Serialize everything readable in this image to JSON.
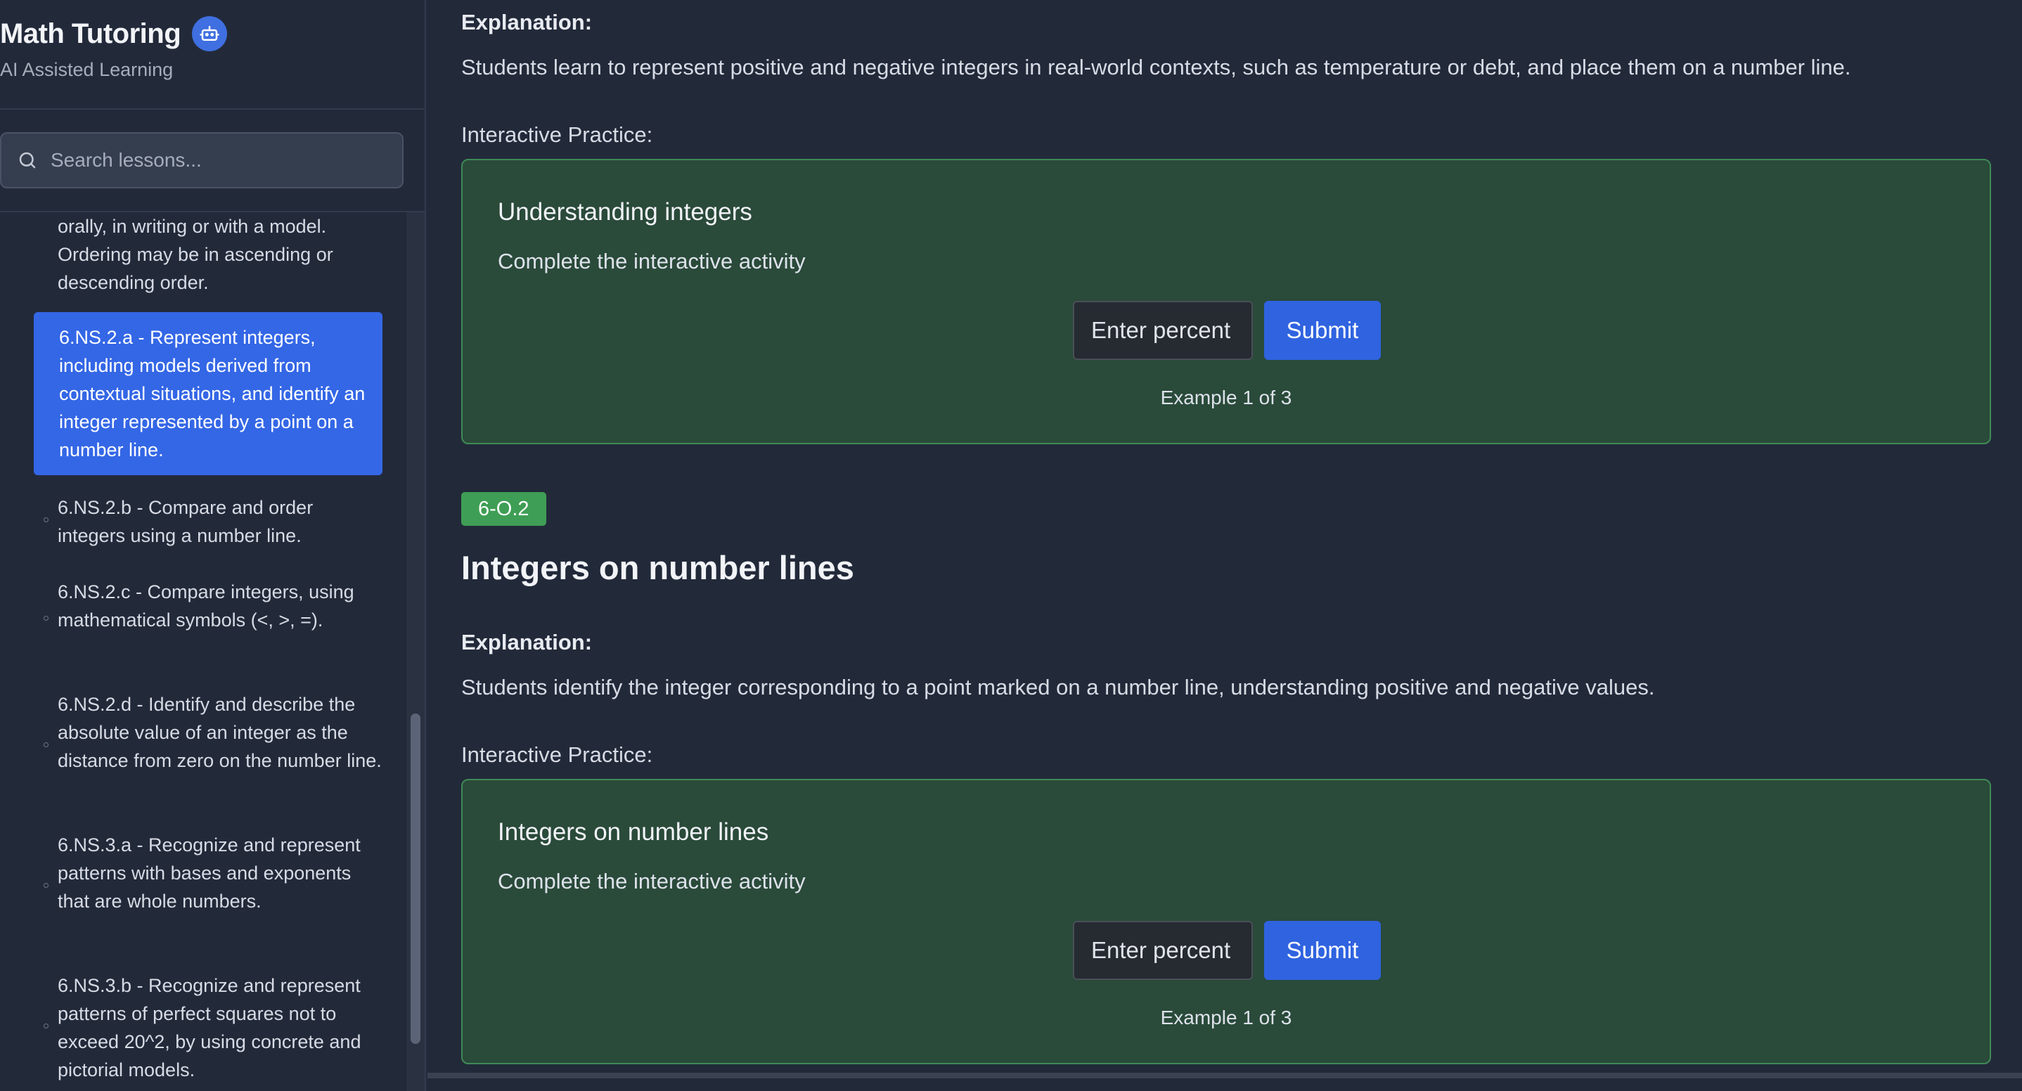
{
  "app": {
    "title": "Math Tutoring",
    "subtitle": "AI Assisted Learning",
    "badge_icon": "robot-icon",
    "accent": "#3467e6"
  },
  "search": {
    "placeholder": "Search lessons..."
  },
  "lessons": [
    {
      "text": "orally, in writing or with a model. Ordering may be in ascending or descending order.",
      "active": false
    },
    {
      "text": "6.NS.2.a - Represent integers, including models derived from contextual situations, and identify an integer represented by a point on a number line.",
      "active": true
    },
    {
      "text": "6.NS.2.b - Compare and order integers using a number line.",
      "active": false
    },
    {
      "text": "6.NS.2.c - Compare integers, using mathematical symbols (<, >, =).",
      "active": false
    },
    {
      "text": "6.NS.2.d - Identify and describe the absolute value of an integer as the distance from zero on the number line.",
      "active": false
    },
    {
      "text": "6.NS.3.a - Recognize and represent patterns with bases and exponents that are whole numbers.",
      "active": false
    },
    {
      "text": "6.NS.3.b - Recognize and represent patterns of perfect squares not to exceed 20^2, by using concrete and pictorial models.",
      "active": false
    }
  ],
  "sections": [
    {
      "explanation_label": "Explanation:",
      "explanation": "Students learn to represent positive and negative integers in real-world contexts, such as temperature or debt, and place them on a number line.",
      "practice_label": "Interactive Practice:",
      "card": {
        "title": "Understanding integers",
        "subtitle": "Complete the interactive activity",
        "input_placeholder": "Enter percent",
        "submit_label": "Submit",
        "counter": "Example 1 of 3"
      }
    },
    {
      "tag": "6-O.2",
      "title": "Integers on number lines",
      "explanation_label": "Explanation:",
      "explanation": "Students identify the integer corresponding to a point marked on a number line, understanding positive and negative values.",
      "practice_label": "Interactive Practice:",
      "card": {
        "title": "Integers on number lines",
        "subtitle": "Complete the interactive activity",
        "input_placeholder": "Enter percent",
        "submit_label": "Submit",
        "counter": "Example 1 of 3"
      }
    }
  ]
}
